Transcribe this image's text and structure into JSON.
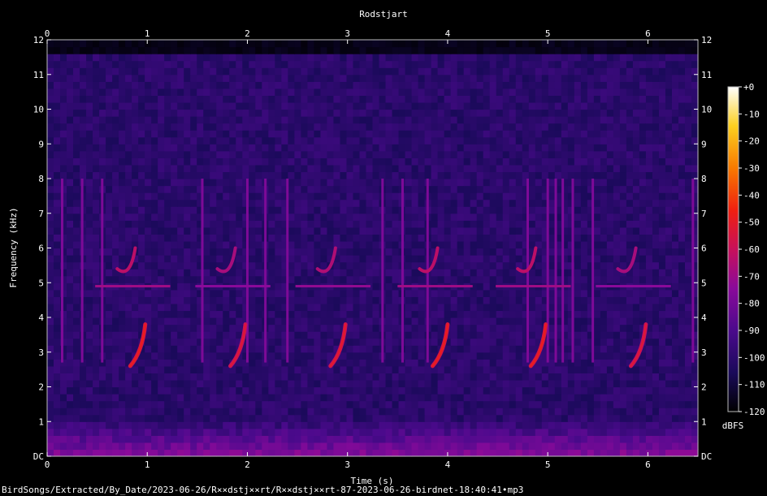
{
  "chart_data": {
    "type": "heatmap",
    "title": "Rodstjart",
    "xlabel": "Time (s)",
    "ylabel": "Frequency (kHz)",
    "xlim": [
      0,
      6.5
    ],
    "ylim": [
      0,
      12
    ],
    "x_ticks": [
      "0",
      "1",
      "2",
      "3",
      "4",
      "5",
      "6"
    ],
    "y_ticks": [
      "DC",
      "1",
      "2",
      "3",
      "4",
      "5",
      "6",
      "7",
      "8",
      "9",
      "10",
      "11",
      "12"
    ],
    "colorbar": {
      "label": "dBFS",
      "range": [
        -120,
        0
      ],
      "ticks": [
        "+0",
        "-10",
        "-20",
        "-30",
        "-40",
        "-50",
        "-60",
        "-70",
        "-80",
        "-90",
        "-100",
        "-110",
        "-120"
      ],
      "colors": [
        "#000000",
        "#1a0a5a",
        "#4b0a8c",
        "#8a0a9a",
        "#c8105a",
        "#f02010",
        "#f87a00",
        "#fcd020",
        "#ffffff"
      ]
    },
    "background_level_dbfs": -100,
    "noise_ceiling_khz": 11.6,
    "song_phrases": [
      {
        "time_s": 0.88,
        "sweep_khz": [
          2.6,
          3.0,
          3.8,
          4.9,
          6.0
        ],
        "peak_dbfs": -55
      },
      {
        "time_s": 1.88,
        "sweep_khz": [
          2.6,
          3.0,
          3.8,
          4.9,
          6.0
        ],
        "peak_dbfs": -60
      },
      {
        "time_s": 2.88,
        "sweep_khz": [
          2.6,
          3.0,
          3.8,
          4.9,
          6.0
        ],
        "peak_dbfs": -58
      },
      {
        "time_s": 3.9,
        "sweep_khz": [
          2.6,
          3.0,
          3.8,
          4.9,
          6.0
        ],
        "peak_dbfs": -55
      },
      {
        "time_s": 4.88,
        "sweep_khz": [
          2.6,
          3.0,
          3.8,
          4.9,
          6.0
        ],
        "peak_dbfs": -55
      },
      {
        "time_s": 5.88,
        "sweep_khz": [
          2.6,
          3.0,
          3.8,
          4.9,
          6.0
        ],
        "peak_dbfs": -60
      }
    ],
    "clicks_s": [
      0.15,
      0.35,
      0.55,
      1.55,
      2.0,
      2.18,
      2.4,
      3.35,
      3.55,
      3.8,
      4.8,
      5.0,
      5.08,
      5.15,
      5.25,
      5.45,
      6.45
    ]
  },
  "footer": "BirdSongs/Extracted/By_Date/2023-06-26/R××dstj××rt/R××dstj××rt-87-2023-06-26-birdnet-18:40:41•mp3"
}
